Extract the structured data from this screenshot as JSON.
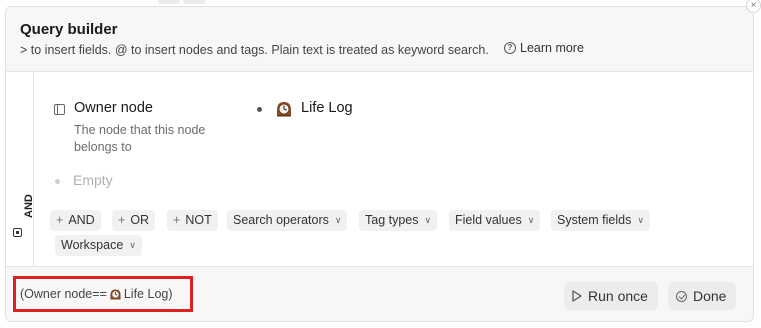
{
  "dialog": {
    "title": "Query builder",
    "subtitle": "> to insert fields. @ to insert nodes and tags. Plain text is treated as keyword search.",
    "learn_more": "Learn more",
    "close_glyph": "×"
  },
  "group": {
    "operator": "AND"
  },
  "field": {
    "name": "Owner node",
    "description": "The node that this node belongs to",
    "value": "Life Log",
    "value_icon": "mantel-clock-icon"
  },
  "empty_row": {
    "label": "Empty"
  },
  "chips": [
    {
      "label": "AND",
      "plus": true
    },
    {
      "label": "OR",
      "plus": true
    },
    {
      "label": "NOT",
      "plus": true
    },
    {
      "label": "Search operators",
      "dropdown": true
    },
    {
      "label": "Tag types",
      "dropdown": true
    },
    {
      "label": "Field values",
      "dropdown": true
    },
    {
      "label": "System fields",
      "dropdown": true
    },
    {
      "label": "Workspace",
      "dropdown": true
    }
  ],
  "footer": {
    "query_prefix": "(Owner node==",
    "query_value": "Life Log)",
    "run_once": "Run once",
    "done": "Done"
  },
  "colors": {
    "highlight": "#e02020",
    "header_bg": "#f7f7f7",
    "chip_bg": "#f1f1f1"
  }
}
